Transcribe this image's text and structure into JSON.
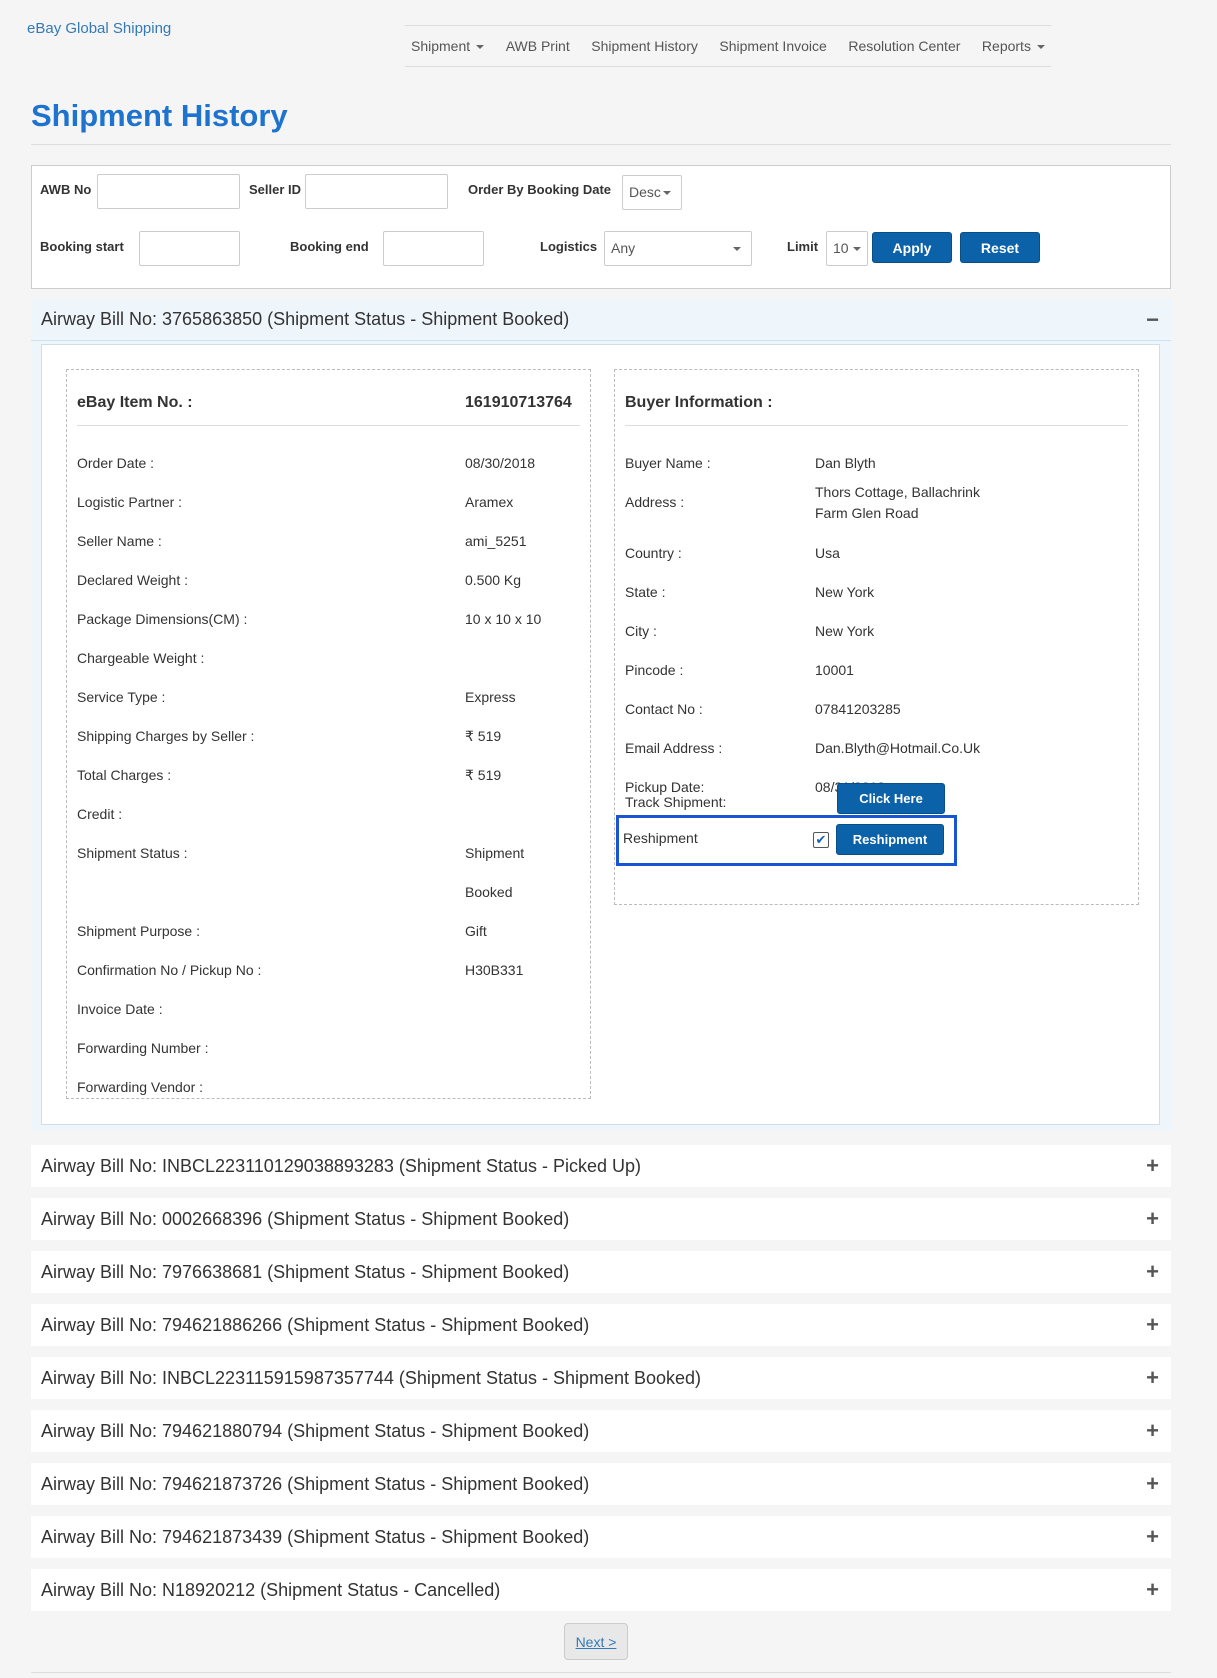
{
  "brand": "eBay Global Shipping",
  "nav": {
    "items": [
      {
        "label": "Shipment",
        "dropdown": true
      },
      {
        "label": "AWB Print",
        "dropdown": false
      },
      {
        "label": "Shipment History",
        "dropdown": false
      },
      {
        "label": "Shipment Invoice",
        "dropdown": false
      },
      {
        "label": "Resolution Center",
        "dropdown": false
      },
      {
        "label": "Reports",
        "dropdown": true
      }
    ]
  },
  "page_title": "Shipment History",
  "filters": {
    "awb_label": "AWB No",
    "awb_value": "",
    "seller_label": "Seller ID",
    "seller_value": "",
    "order_label": "Order By Booking Date",
    "order_value": "Desc",
    "booking_start_label": "Booking start",
    "booking_start_value": "",
    "booking_end_label": "Booking end",
    "booking_end_value": "",
    "logistics_label": "Logistics",
    "logistics_value": "Any",
    "limit_label": "Limit",
    "limit_value": "10",
    "apply": "Apply",
    "reset": "Reset"
  },
  "expanded": {
    "title": "Airway Bill No: 3765863850 (Shipment Status - Shipment Booked)",
    "toggle": "−",
    "item": {
      "heading_label": "eBay Item No. :",
      "heading_value": "161910713764",
      "rows": [
        {
          "label": "Order Date :",
          "value": "08/30/2018"
        },
        {
          "label": "Logistic Partner :",
          "value": "Aramex"
        },
        {
          "label": "Seller Name :",
          "value": "ami_5251"
        },
        {
          "label": "Declared Weight :",
          "value": "0.500 Kg"
        },
        {
          "label": "Package Dimensions(CM) :",
          "value": "10 x 10 x 10"
        },
        {
          "label": "Chargeable Weight :",
          "value": ""
        },
        {
          "label": "Service Type :",
          "value": "Express"
        },
        {
          "label": "Shipping Charges by Seller :",
          "value": "₹ 519"
        },
        {
          "label": "Total Charges :",
          "value": "₹ 519"
        },
        {
          "label": "Credit :",
          "value": ""
        },
        {
          "label": "Shipment Status :",
          "value": "Shipment"
        },
        {
          "label": "",
          "value": "Booked"
        },
        {
          "label": "Shipment Purpose :",
          "value": "Gift"
        },
        {
          "label": "Confirmation No / Pickup No :",
          "value": "H30B331"
        },
        {
          "label": "Invoice Date :",
          "value": ""
        },
        {
          "label": "Forwarding Number :",
          "value": ""
        },
        {
          "label": "Forwarding Vendor :",
          "value": ""
        }
      ]
    },
    "buyer": {
      "heading": "Buyer Information :",
      "rows": [
        {
          "label": "Buyer Name :",
          "value": "Dan Blyth"
        },
        {
          "label": "Address :",
          "value": "Thors Cottage, Ballachrink",
          "value2": "Farm Glen Road"
        },
        {
          "label": "Country :",
          "value": "Usa"
        },
        {
          "label": "State :",
          "value": "New York"
        },
        {
          "label": "City :",
          "value": "New York"
        },
        {
          "label": "Pincode :",
          "value": "10001"
        },
        {
          "label": "Contact No :",
          "value": "07841203285"
        },
        {
          "label": "Email Address :",
          "value": "Dan.Blyth@Hotmail.Co.Uk"
        },
        {
          "label": "Pickup Date:",
          "value": "08/31/2018"
        }
      ],
      "track_label": "Track Shipment:",
      "track_button": "Click Here",
      "reship_label": "Reshipment",
      "reship_checked": "✔",
      "reship_button": "Reshipment"
    }
  },
  "collapsed": [
    {
      "title": "Airway Bill No: INBCL223110129038893283 (Shipment Status - Picked Up)",
      "toggle": "+"
    },
    {
      "title": "Airway Bill No: 0002668396 (Shipment Status - Shipment Booked)",
      "toggle": "+"
    },
    {
      "title": "Airway Bill No: 7976638681 (Shipment Status - Shipment Booked)",
      "toggle": "+"
    },
    {
      "title": "Airway Bill No: 794621886266 (Shipment Status - Shipment Booked)",
      "toggle": "+"
    },
    {
      "title": "Airway Bill No: INBCL223115915987357744 (Shipment Status - Shipment Booked)",
      "toggle": "+"
    },
    {
      "title": "Airway Bill No: 794621880794 (Shipment Status - Shipment Booked)",
      "toggle": "+"
    },
    {
      "title": "Airway Bill No: 794621873726 (Shipment Status - Shipment Booked)",
      "toggle": "+"
    },
    {
      "title": "Airway Bill No: 794621873439 (Shipment Status - Shipment Booked)",
      "toggle": "+"
    },
    {
      "title": "Airway Bill No: N18920212 (Shipment Status - Cancelled)",
      "toggle": "+"
    }
  ],
  "pagination": {
    "next": "Next >"
  }
}
